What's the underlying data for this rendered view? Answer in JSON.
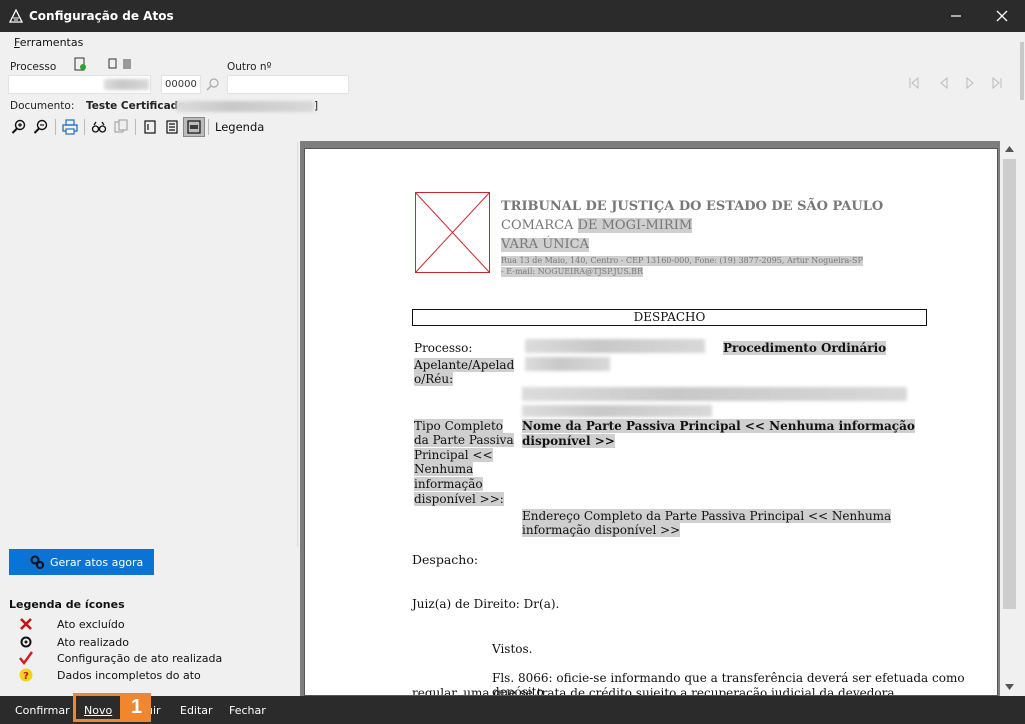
{
  "window": {
    "title": "Configuração de Atos"
  },
  "menu": {
    "ferramentas": "Ferramentas",
    "ferramentas_rest": "erramentas",
    "ferramentas_first": "F"
  },
  "form": {
    "processo_label": "Processo",
    "processo_suffix": "00000",
    "outro_label": "Outro nº",
    "documento_label": "Documento:",
    "documento_value": "Teste Certificado",
    "documento_bracket": "]"
  },
  "toolbar": {
    "legenda_label": "Legenda"
  },
  "left": {
    "gerar_label": "Gerar atos agora",
    "legend_title": "Legenda de ícones",
    "legend_items": [
      {
        "icon": "x-excluded-icon",
        "label": "Ato excluído"
      },
      {
        "icon": "gear-realized-icon",
        "label": "Ato realizado"
      },
      {
        "icon": "checkmark-icon",
        "label": "Configuração de ato realizada"
      },
      {
        "icon": "question-icon",
        "label": "Dados incompletos do ato"
      }
    ]
  },
  "document": {
    "court": "TRIBUNAL DE JUSTIÇA DO ESTADO DE SÃO PAULO",
    "comarca_prefix": "COMARCA ",
    "comarca_name": "DE MOGI-MIRIM",
    "vara": "VARA ÚNICA",
    "address_line1": "Rua 13 de Maio, 140, Centro - CEP 13160-000, Fone: (19) 3877-2095, Artur Nogueira-SP",
    "address_line2": "- E-mail: NOGUEIRA@TJSP.JUS.BR",
    "section_title": "DESPACHO",
    "processo_label": "Processo:",
    "procedimento": "Procedimento Ordinário",
    "apelante_label_1": "Apelante/Apelad",
    "apelante_label_2": "o/Réu:",
    "tipo_label": [
      "Tipo Completo",
      "da Parte Passiva",
      "Principal <<",
      "Nenhuma",
      "informação",
      "disponível >>:"
    ],
    "nome_parte_1": "Nome da Parte Passiva Principal << Nenhuma informação",
    "nome_parte_2": "disponível >>",
    "endereco_1": "Endereço Completo da Parte Passiva Principal << Nenhuma",
    "endereco_2": "informação disponível >>",
    "despacho_label": "Despacho:",
    "juiz": "Juiz(a) de Direito: Dr(a).",
    "vistos": "Vistos.",
    "fls_1": "Fls. 8066: oficie-se informando que a transferência deverá ser efetuada como depósito",
    "fls_2": "regular, uma que se trata de crédito sujeito a recuperação judicial da devedora."
  },
  "bottom": {
    "confirmar": "Confirmar",
    "novo": "Novo",
    "excluir_tail": "uir",
    "editar": "Editar",
    "fechar": "Fechar",
    "callout_number": "1"
  },
  "colors": {
    "accent": "#0a74d6",
    "callout": "#f0862d",
    "titlebar": "#2b2b2b"
  }
}
